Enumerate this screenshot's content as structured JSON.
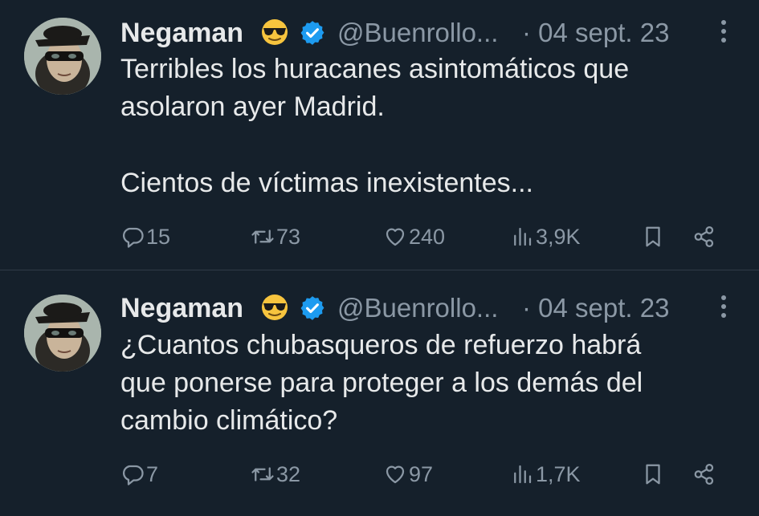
{
  "tweets": [
    {
      "author_name": "Negaman",
      "emoji": "smiling-face-with-sunglasses",
      "handle": "@Buenrollo...",
      "date": "· 04 sept. 23",
      "text_lines": [
        "Terribles los huracanes asintomáticos que",
        "asolaron ayer Madrid.",
        "",
        "Cientos de víctimas inexistentes..."
      ],
      "replies": "15",
      "retweets": "73",
      "likes": "240",
      "views": "3,9K"
    },
    {
      "author_name": "Negaman",
      "emoji": "smiling-face-with-sunglasses",
      "handle": "@Buenrollo...",
      "date": "· 04 sept. 23",
      "text_lines": [
        "¿Cuantos chubasqueros de refuerzo habrá",
        "que ponerse para proteger a los demás del",
        "cambio climático?"
      ],
      "replies": "7",
      "retweets": "32",
      "likes": "97",
      "views": "1,7K"
    }
  ],
  "colors": {
    "background": "#15202b",
    "text": "#e7e9ea",
    "muted": "#8b98a5",
    "verified": "#1d9bf0",
    "divider": "#2f3b47"
  },
  "icons": [
    "reply-icon",
    "retweet-icon",
    "like-icon",
    "views-icon",
    "bookmark-icon",
    "share-icon",
    "more-icon",
    "verified-icon"
  ]
}
